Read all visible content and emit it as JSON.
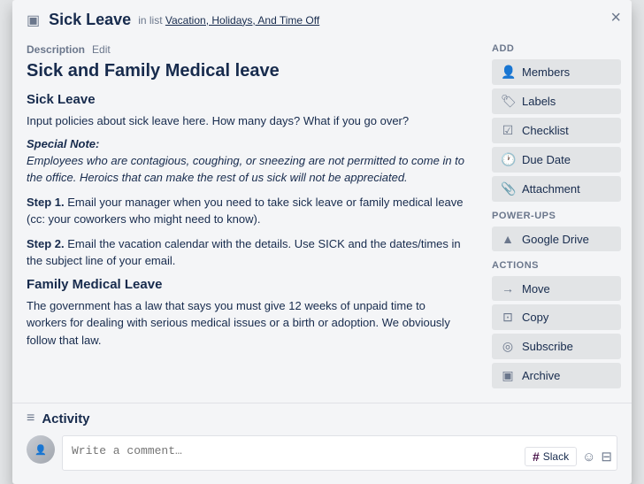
{
  "modal": {
    "title": "Sick Leave",
    "subtitle_prefix": "in list",
    "subtitle_link": "Vacation, Holidays, And Time Off",
    "close_label": "×"
  },
  "description": {
    "label": "Description",
    "edit_label": "Edit"
  },
  "card": {
    "title": "Sick and Family Medical leave",
    "sections": [
      {
        "type": "heading",
        "text": "Sick Leave"
      },
      {
        "type": "paragraph",
        "text": "Input policies about sick leave here. How many days? What if you go over?"
      },
      {
        "type": "special_note_label",
        "text": "Special Note:"
      },
      {
        "type": "special_note",
        "text": "Employees who are contagious, coughing, or sneezing are not permitted to come in to the office. Heroics that can make the rest of us sick will not be appreciated."
      },
      {
        "type": "step",
        "bold": "Step 1.",
        "text": " Email your manager when you need to take sick leave or family medical leave (cc: your coworkers who might need to know)."
      },
      {
        "type": "step",
        "bold": "Step 2.",
        "text": " Email the vacation calendar with the details. Use SICK and the dates/times in the subject line of your email."
      },
      {
        "type": "heading",
        "text": "Family Medical Leave"
      },
      {
        "type": "paragraph",
        "text": "The government has a law that says you must give 12 weeks of unpaid time to workers for dealing with serious medical issues or a birth or adoption. We obviously follow that law."
      }
    ]
  },
  "activity": {
    "title": "Activity",
    "comment_placeholder": "Write a comment…"
  },
  "comment_actions": {
    "slack_label": "Slack",
    "emoji_icon": "😊",
    "attach_icon": "📎"
  },
  "sidebar": {
    "add_section": "Add",
    "power_ups_section": "Power-Ups",
    "actions_section": "Actions",
    "buttons": {
      "add": [
        {
          "icon": "👤",
          "label": "Members",
          "name": "members-button"
        },
        {
          "icon": "🏷",
          "label": "Labels",
          "name": "labels-button"
        },
        {
          "icon": "☑",
          "label": "Checklist",
          "name": "checklist-button"
        },
        {
          "icon": "🕐",
          "label": "Due Date",
          "name": "due-date-button"
        },
        {
          "icon": "📎",
          "label": "Attachment",
          "name": "attachment-button"
        }
      ],
      "power_ups": [
        {
          "icon": "▲",
          "label": "Google Drive",
          "name": "google-drive-button"
        }
      ],
      "actions": [
        {
          "icon": "→",
          "label": "Move",
          "name": "move-button"
        },
        {
          "icon": "⊡",
          "label": "Copy",
          "name": "copy-button"
        },
        {
          "icon": "◎",
          "label": "Subscribe",
          "name": "subscribe-button"
        },
        {
          "icon": "▣",
          "label": "Archive",
          "name": "archive-button"
        }
      ]
    }
  },
  "icons": {
    "card_header_icon": "▣",
    "activity_icon": "≡",
    "close_icon": "✕"
  }
}
